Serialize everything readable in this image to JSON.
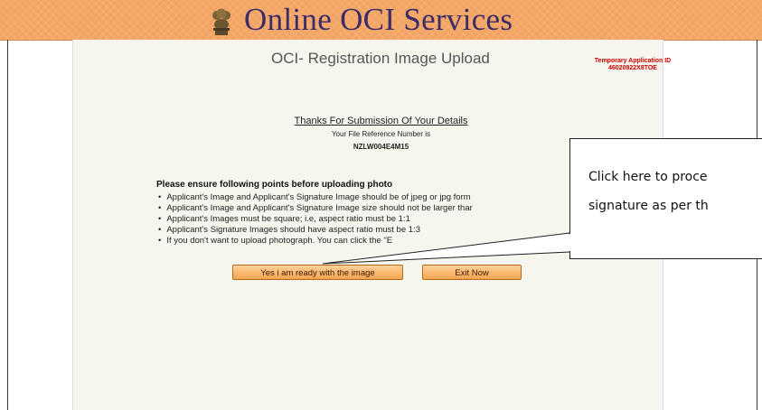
{
  "header": {
    "title": "Online OCI Services",
    "emblem_icon": "national-emblem-icon"
  },
  "page": {
    "title": "OCI- Registration Image Upload",
    "temp_id_label": "Temporary Application ID",
    "temp_id_value": "46020922X8TOE",
    "thanks": "Thanks For Submission Of Your Details",
    "ref_label": "Your File Reference Number is",
    "ref_number": "NZLW004E4M15"
  },
  "instructions": {
    "heading": "Please ensure following points before uploading photo",
    "points": [
      "Applicant's Image and Applicant's Signature Image should be of jpeg or jpg form",
      "Applicant's Image and Applicant's Signature Image size should not be larger thar",
      "Applicant's Images must be square; i.e, aspect ratio must be 1:1",
      "Applicant's Signature Images should have aspect ratio must be 1:3",
      "If you don't want to upload photograph. You can click the \"E"
    ]
  },
  "buttons": {
    "ready": "Yes i am ready with the image",
    "exit": "Exit Now"
  },
  "callout": {
    "line1": "Click here to proce",
    "line2": "signature as per th"
  },
  "colors": {
    "header_bg": "#f4a766",
    "title_color": "#3c2c6a",
    "temp_id_color": "#d00000",
    "button_bg": "#f4a450"
  }
}
